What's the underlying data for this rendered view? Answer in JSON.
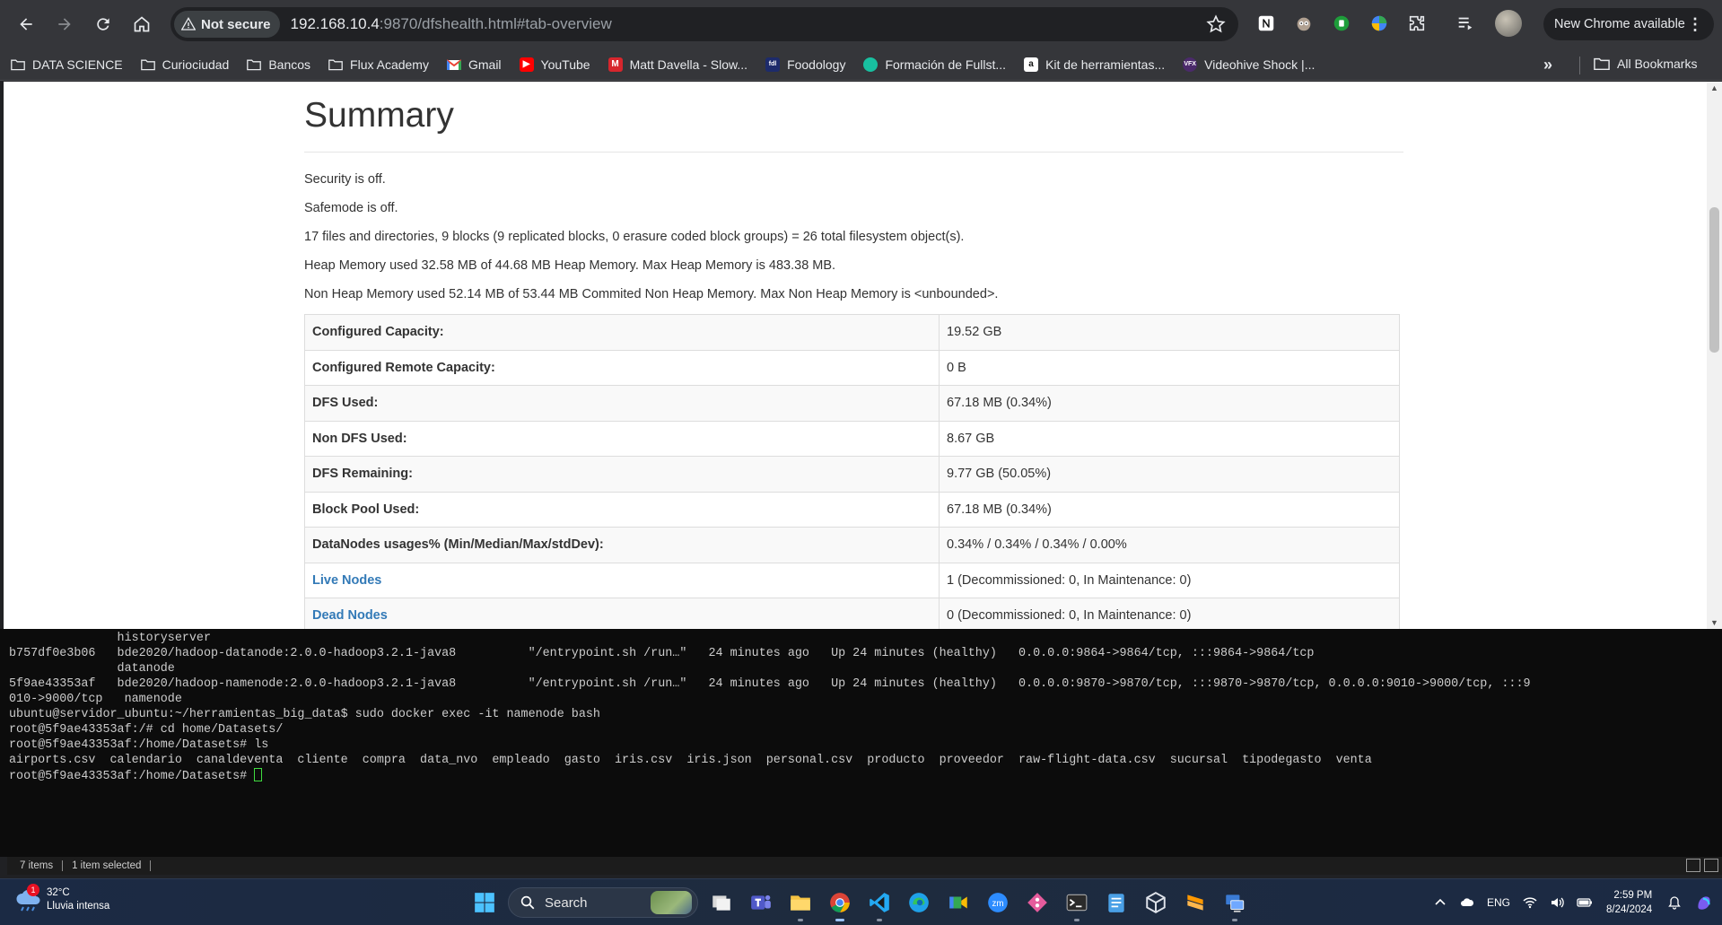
{
  "browser": {
    "security_label": "Not secure",
    "url_host": "192.168.10.4",
    "url_rest": ":9870/dfshealth.html#tab-overview",
    "update_label": "New Chrome available"
  },
  "bookmarks": [
    {
      "label": "DATA SCIENCE",
      "icon": "folder-icon"
    },
    {
      "label": "Curiociudad",
      "icon": "folder-icon"
    },
    {
      "label": "Bancos",
      "icon": "folder-icon"
    },
    {
      "label": "Flux Academy",
      "icon": "folder-icon"
    },
    {
      "label": "Gmail",
      "icon": "gmail-icon"
    },
    {
      "label": "YouTube",
      "icon": "youtube-icon"
    },
    {
      "label": "Matt Davella - Slow...",
      "icon": "matt-davella-icon"
    },
    {
      "label": "Foodology",
      "icon": "foodology-icon"
    },
    {
      "label": "Formación de Fullst...",
      "icon": "formacion-icon"
    },
    {
      "label": "Kit de herramientas...",
      "icon": "amazon-icon"
    },
    {
      "label": "Videohive Shock |...",
      "icon": "videohive-icon"
    }
  ],
  "bookmarks_more": "»",
  "all_bookmarks": "All Bookmarks",
  "page": {
    "title": "Summary",
    "info": [
      "Security is off.",
      "Safemode is off.",
      "17 files and directories, 9 blocks (9 replicated blocks, 0 erasure coded block groups) = 26 total filesystem object(s).",
      "Heap Memory used 32.58 MB of 44.68 MB Heap Memory. Max Heap Memory is 483.38 MB.",
      "Non Heap Memory used 52.14 MB of 53.44 MB Commited Non Heap Memory. Max Non Heap Memory is <unbounded>."
    ],
    "rows": [
      {
        "key": "Configured Capacity:",
        "value": "19.52 GB",
        "link": false
      },
      {
        "key": "Configured Remote Capacity:",
        "value": "0 B",
        "link": false
      },
      {
        "key": "DFS Used:",
        "value": "67.18 MB (0.34%)",
        "link": false
      },
      {
        "key": "Non DFS Used:",
        "value": "8.67 GB",
        "link": false
      },
      {
        "key": "DFS Remaining:",
        "value": "9.77 GB (50.05%)",
        "link": false
      },
      {
        "key": "Block Pool Used:",
        "value": "67.18 MB (0.34%)",
        "link": false
      },
      {
        "key": "DataNodes usages% (Min/Median/Max/stdDev):",
        "value": "0.34% / 0.34% / 0.34% / 0.00%",
        "link": false
      },
      {
        "key": "Live Nodes",
        "value": "1 (Decommissioned: 0, In Maintenance: 0)",
        "link": true
      },
      {
        "key": "Dead Nodes",
        "value": "0 (Decommissioned: 0, In Maintenance: 0)",
        "link": true
      }
    ]
  },
  "terminal": {
    "lines": [
      "               historyserver",
      "b757df0e3b06   bde2020/hadoop-datanode:2.0.0-hadoop3.2.1-java8          \"/entrypoint.sh /run…\"   24 minutes ago   Up 24 minutes (healthy)   0.0.0.0:9864->9864/tcp, :::9864->9864/tcp",
      "               datanode",
      "5f9ae43353af   bde2020/hadoop-namenode:2.0.0-hadoop3.2.1-java8          \"/entrypoint.sh /run…\"   24 minutes ago   Up 24 minutes (healthy)   0.0.0.0:9870->9870/tcp, :::9870->9870/tcp, 0.0.0.0:9010->9000/tcp, :::9",
      "010->9000/tcp   namenode",
      "ubuntu@servidor_ubuntu:~/herramientas_big_data$ sudo docker exec -it namenode bash",
      "root@5f9ae43353af:/# cd home/Datasets/",
      "root@5f9ae43353af:/home/Datasets# ls",
      "airports.csv  calendario  canaldeventa  cliente  compra  data_nvo  empleado  gasto  iris.csv  iris.json  personal.csv  producto  proveedor  raw-flight-data.csv  sucursal  tipodegasto  venta"
    ],
    "prompt": "root@5f9ae43353af:/home/Datasets# "
  },
  "explorer_status": {
    "items": "7 items",
    "selected": "1 item selected"
  },
  "taskbar": {
    "weather_temp": "32°C",
    "weather_desc": "Lluvia intensa",
    "weather_badge": "1",
    "search_label": "Search",
    "language": "ENG",
    "time": "2:59 PM",
    "date": "8/24/2024"
  }
}
